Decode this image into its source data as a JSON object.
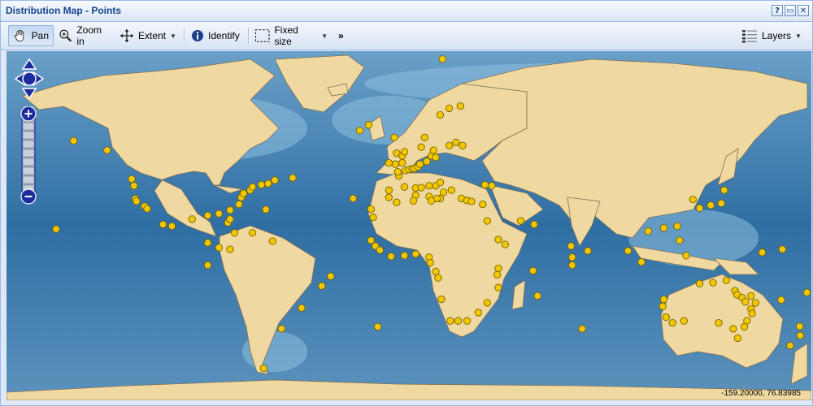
{
  "window": {
    "title": "Distribution Map - Points"
  },
  "title_tools": [
    {
      "icon": "help-icon",
      "glyph": "?"
    },
    {
      "icon": "maximize-icon",
      "glyph": "▭"
    },
    {
      "icon": "close-icon",
      "glyph": "✕"
    }
  ],
  "toolbar": {
    "pan_label": "Pan",
    "zoom_in_label": "Zoom in",
    "extent_label": "Extent",
    "identify_label": "Identify",
    "fixed_size_label": "Fixed size",
    "more_label": "»",
    "layers_label": "Layers"
  },
  "map": {
    "coordinates": "-159.20000, 76.83985",
    "colors": {
      "land": "#f0d9a0",
      "ocean_deep": "#1f5590",
      "ocean_shallow": "#7fb2d6",
      "point": "#f2c700",
      "point_outline": "#7a6400"
    },
    "zoom_levels": 8,
    "points": [
      {
        "lon": -122.4,
        "lat": 37.8
      },
      {
        "lon": -118.2,
        "lat": 34.0
      },
      {
        "lon": -117.1,
        "lat": 32.7
      },
      {
        "lon": -123.0,
        "lat": 44.0
      },
      {
        "lon": -124.0,
        "lat": 47.0
      },
      {
        "lon": -121.9,
        "lat": 36.6
      },
      {
        "lon": -110.0,
        "lat": 24.0
      },
      {
        "lon": -106.0,
        "lat": 23.0
      },
      {
        "lon": -97.0,
        "lat": 27.0
      },
      {
        "lon": -90.0,
        "lat": 29.0
      },
      {
        "lon": -85.0,
        "lat": 30.0
      },
      {
        "lon": -81.0,
        "lat": 25.0
      },
      {
        "lon": -80.0,
        "lat": 27.0
      },
      {
        "lon": -80.0,
        "lat": 32.0
      },
      {
        "lon": -76.0,
        "lat": 35.0
      },
      {
        "lon": -75.0,
        "lat": 38.5
      },
      {
        "lon": -74.0,
        "lat": 40.5
      },
      {
        "lon": -71.0,
        "lat": 42.0
      },
      {
        "lon": -70.0,
        "lat": 43.5
      },
      {
        "lon": -66.0,
        "lat": 44.5
      },
      {
        "lon": -63.0,
        "lat": 45.0
      },
      {
        "lon": -60.0,
        "lat": 46.5
      },
      {
        "lon": -52.0,
        "lat": 47.5
      },
      {
        "lon": -64.0,
        "lat": 32.3
      },
      {
        "lon": -157.8,
        "lat": 21.3
      },
      {
        "lon": -150.0,
        "lat": 61.0
      },
      {
        "lon": -135.0,
        "lat": 58.0
      },
      {
        "lon": -90.0,
        "lat": 13.0
      },
      {
        "lon": -80.0,
        "lat": 9.0
      },
      {
        "lon": -85.0,
        "lat": 10.0
      },
      {
        "lon": -90.0,
        "lat": -1.0
      },
      {
        "lon": -78.0,
        "lat": 19.0
      },
      {
        "lon": -70.0,
        "lat": 19.0
      },
      {
        "lon": -61.0,
        "lat": 14.0
      },
      {
        "lon": -35.0,
        "lat": -8.0
      },
      {
        "lon": -39.0,
        "lat": -14.0
      },
      {
        "lon": -48.0,
        "lat": -27.0
      },
      {
        "lon": -57.0,
        "lat": -38.0
      },
      {
        "lon": -65.0,
        "lat": -55.0
      },
      {
        "lon": -14.0,
        "lat": -37.0
      },
      {
        "lon": -25.0,
        "lat": 38.0
      },
      {
        "lon": -17.0,
        "lat": 32.5
      },
      {
        "lon": -16.0,
        "lat": 28.0
      },
      {
        "lon": -17.0,
        "lat": 14.5
      },
      {
        "lon": -15.0,
        "lat": 11.0
      },
      {
        "lon": -13.0,
        "lat": 8.5
      },
      {
        "lon": -8.0,
        "lat": 4.5
      },
      {
        "lon": -2.0,
        "lat": 5.0
      },
      {
        "lon": 3.0,
        "lat": 6.0
      },
      {
        "lon": 9.0,
        "lat": 4.0
      },
      {
        "lon": 9.5,
        "lat": 0.5
      },
      {
        "lon": 12.0,
        "lat": -5.0
      },
      {
        "lon": 13.0,
        "lat": -9.0
      },
      {
        "lon": 14.5,
        "lat": -22.0
      },
      {
        "lon": 18.5,
        "lat": -34.0
      },
      {
        "lon": 22.0,
        "lat": -34.0
      },
      {
        "lon": 26.0,
        "lat": -34.0
      },
      {
        "lon": 31.0,
        "lat": -29.5
      },
      {
        "lon": 35.0,
        "lat": -24.0
      },
      {
        "lon": 40.0,
        "lat": -15.0
      },
      {
        "lon": 39.5,
        "lat": -7.0
      },
      {
        "lon": 40.0,
        "lat": -3.0
      },
      {
        "lon": 43.0,
        "lat": 12.0
      },
      {
        "lon": 40.0,
        "lat": 15.0
      },
      {
        "lon": 35.0,
        "lat": 26.0
      },
      {
        "lon": 50.0,
        "lat": 26.0
      },
      {
        "lon": 56.0,
        "lat": 24.0
      },
      {
        "lon": 57.5,
        "lat": -20.0
      },
      {
        "lon": 55.5,
        "lat": -4.5
      },
      {
        "lon": 73.0,
        "lat": 4.0
      },
      {
        "lon": 73.0,
        "lat": -1.0
      },
      {
        "lon": 80.0,
        "lat": 8.0
      },
      {
        "lon": 72.5,
        "lat": 11.0
      },
      {
        "lon": 77.5,
        "lat": -38.0
      },
      {
        "lon": 98.0,
        "lat": 8.0
      },
      {
        "lon": 104.0,
        "lat": 1.0
      },
      {
        "lon": 107.0,
        "lat": 20.0
      },
      {
        "lon": 114.0,
        "lat": 22.0
      },
      {
        "lon": 121.0,
        "lat": 14.5
      },
      {
        "lon": 120.0,
        "lat": 23.0
      },
      {
        "lon": 124.0,
        "lat": 5.0
      },
      {
        "lon": 130.0,
        "lat": 33.0
      },
      {
        "lon": 135.0,
        "lat": 34.5
      },
      {
        "lon": 139.7,
        "lat": 35.5
      },
      {
        "lon": 141.0,
        "lat": 42.0
      },
      {
        "lon": 127.0,
        "lat": 37.5
      },
      {
        "lon": 114.0,
        "lat": -22.0
      },
      {
        "lon": 113.5,
        "lat": -26.0
      },
      {
        "lon": 115.0,
        "lat": -32.0
      },
      {
        "lon": 117.9,
        "lat": -35.0
      },
      {
        "lon": 123.0,
        "lat": -34.0
      },
      {
        "lon": 130.0,
        "lat": -12.5
      },
      {
        "lon": 136.0,
        "lat": -12.0
      },
      {
        "lon": 142.0,
        "lat": -10.5
      },
      {
        "lon": 145.8,
        "lat": -16.9
      },
      {
        "lon": 146.8,
        "lat": -19.3
      },
      {
        "lon": 149.0,
        "lat": -21.0
      },
      {
        "lon": 150.5,
        "lat": -23.5
      },
      {
        "lon": 153.0,
        "lat": -27.5
      },
      {
        "lon": 153.5,
        "lat": -30.0
      },
      {
        "lon": 151.2,
        "lat": -33.9
      },
      {
        "lon": 150.0,
        "lat": -37.0
      },
      {
        "lon": 145.0,
        "lat": -38.0
      },
      {
        "lon": 138.5,
        "lat": -35.0
      },
      {
        "lon": 147.0,
        "lat": -42.5
      },
      {
        "lon": 153.0,
        "lat": -20.0
      },
      {
        "lon": 155.0,
        "lat": -24.0
      },
      {
        "lon": 166.5,
        "lat": -22.3
      },
      {
        "lon": 178.0,
        "lat": -18.0
      },
      {
        "lon": 174.8,
        "lat": -36.8
      },
      {
        "lon": 175.0,
        "lat": -41.3
      },
      {
        "lon": 170.5,
        "lat": -45.9
      },
      {
        "lon": 158.0,
        "lat": 7.0
      },
      {
        "lon": 167.0,
        "lat": 9.0
      },
      {
        "lon": -9.0,
        "lat": 38.5
      },
      {
        "lon": -9.0,
        "lat": 42.0
      },
      {
        "lon": -2.0,
        "lat": 43.5
      },
      {
        "lon": -4.5,
        "lat": 48.3
      },
      {
        "lon": -1.5,
        "lat": 50.5
      },
      {
        "lon": -5.0,
        "lat": 50.0
      },
      {
        "lon": -3.0,
        "lat": 53.5
      },
      {
        "lon": -6.0,
        "lat": 53.0
      },
      {
        "lon": -9.0,
        "lat": 53.5
      },
      {
        "lon": -5.5,
        "lat": 57.0
      },
      {
        "lon": -3.0,
        "lat": 56.0
      },
      {
        "lon": -2.0,
        "lat": 57.5
      },
      {
        "lon": 0.0,
        "lat": 51.0
      },
      {
        "lon": 1.5,
        "lat": 51.2
      },
      {
        "lon": 2.5,
        "lat": 51.3
      },
      {
        "lon": 4.0,
        "lat": 52.0
      },
      {
        "lon": 5.0,
        "lat": 53.0
      },
      {
        "lon": 8.0,
        "lat": 54.0
      },
      {
        "lon": 10.0,
        "lat": 56.0
      },
      {
        "lon": 12.0,
        "lat": 55.5
      },
      {
        "lon": 11.0,
        "lat": 58.0
      },
      {
        "lon": 5.5,
        "lat": 59.0
      },
      {
        "lon": 7.0,
        "lat": 62.0
      },
      {
        "lon": 14.0,
        "lat": 68.0
      },
      {
        "lon": 18.0,
        "lat": 69.5
      },
      {
        "lon": 23.0,
        "lat": 70.0
      },
      {
        "lon": -22.0,
        "lat": 64.0
      },
      {
        "lon": -18.0,
        "lat": 65.5
      },
      {
        "lon": -6.5,
        "lat": 62.0
      },
      {
        "lon": 15.0,
        "lat": 78.0
      },
      {
        "lon": 3.0,
        "lat": 43.0
      },
      {
        "lon": 5.5,
        "lat": 43.2
      },
      {
        "lon": 9.0,
        "lat": 44.0
      },
      {
        "lon": 12.0,
        "lat": 44.0
      },
      {
        "lon": 14.0,
        "lat": 45.5
      },
      {
        "lon": 15.5,
        "lat": 41.0
      },
      {
        "lon": 14.0,
        "lat": 38.0
      },
      {
        "lon": 12.5,
        "lat": 38.0
      },
      {
        "lon": 9.0,
        "lat": 39.0
      },
      {
        "lon": 3.0,
        "lat": 39.5
      },
      {
        "lon": 19.0,
        "lat": 42.0
      },
      {
        "lon": 23.5,
        "lat": 38.0
      },
      {
        "lon": 26.0,
        "lat": 37.0
      },
      {
        "lon": 28.0,
        "lat": 36.5
      },
      {
        "lon": 33.0,
        "lat": 35.0
      },
      {
        "lon": -5.5,
        "lat": 36.0
      },
      {
        "lon": 2.0,
        "lat": 36.8
      },
      {
        "lon": 10.0,
        "lat": 36.8
      },
      {
        "lon": 18.0,
        "lat": 59.5
      },
      {
        "lon": 21.0,
        "lat": 60.5
      },
      {
        "lon": 24.0,
        "lat": 59.5
      },
      {
        "lon": 34.0,
        "lat": 44.5
      },
      {
        "lon": 37.0,
        "lat": 44.0
      }
    ]
  }
}
